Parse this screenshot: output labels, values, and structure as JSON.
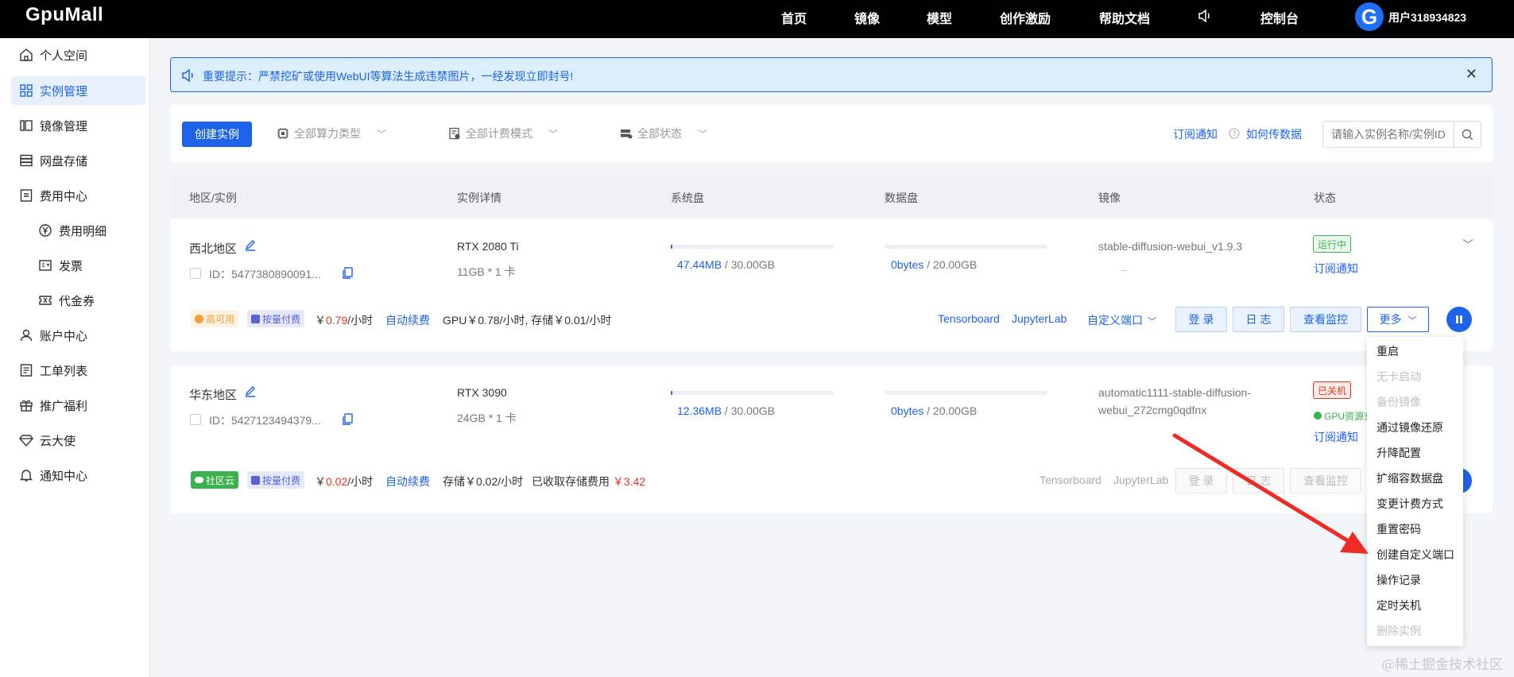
{
  "topbar": {
    "logo": "GpuMall",
    "nav": [
      "首页",
      "镜像",
      "模型",
      "创作激励",
      "帮助文档"
    ],
    "console": "控制台",
    "avatar_letter": "G",
    "username": "用户318934823"
  },
  "sidebar": {
    "items": [
      {
        "label": "个人空间",
        "icon": "home-icon"
      },
      {
        "label": "实例管理",
        "icon": "grid-icon"
      },
      {
        "label": "镜像管理",
        "icon": "mirror-icon"
      },
      {
        "label": "网盘存储",
        "icon": "storage-icon"
      },
      {
        "label": "费用中心",
        "icon": "billing-icon"
      },
      {
        "label": "费用明细",
        "icon": "yen-icon"
      },
      {
        "label": "发票",
        "icon": "invoice-icon"
      },
      {
        "label": "代金券",
        "icon": "coupon-icon"
      },
      {
        "label": "账户中心",
        "icon": "user-icon"
      },
      {
        "label": "工单列表",
        "icon": "ticket-icon"
      },
      {
        "label": "推广福利",
        "icon": "gift-icon"
      },
      {
        "label": "云大使",
        "icon": "diamond-icon"
      },
      {
        "label": "通知中心",
        "icon": "bell-icon"
      }
    ]
  },
  "notice": {
    "text": "重要提示：严禁挖矿或使用WebUI等算法生成违禁图片，一经发现立即封号!",
    "close": "✕"
  },
  "toolbar": {
    "create_label": "创建实例",
    "filter_compute": "全部算力类型",
    "filter_billing": "全部计费模式",
    "filter_status": "全部状态",
    "subscribe_link": "订阅通知",
    "transfer_link": "如何传数据",
    "search_placeholder": "请输入实例名称/实例ID"
  },
  "table": {
    "headers": [
      "地区/实例",
      "实例详情",
      "系统盘",
      "数据盘",
      "镜像",
      "状态"
    ]
  },
  "instances": [
    {
      "region": "西北地区",
      "id": "ID：5477380890091...",
      "gpu": "RTX 2080 Ti",
      "gpu_spec": "11GB * 1 卡",
      "sys_used": "47.44MB",
      "sys_total": " / 30.00GB",
      "sys_fill_pct": 1,
      "data_used": "0bytes",
      "data_total": " / 20.00GB",
      "image": "stable-diffusion-webui_v1.9.3",
      "image_line2": "",
      "status": "运行中",
      "status_extra": "",
      "subscribe": "订阅通知",
      "availability": "高可用",
      "pay_mode": "按量付费",
      "price_prefix": "￥",
      "price": "0.79",
      "price_unit": "/小时",
      "renew": "自动续费",
      "cost_detail": "GPU￥0.78/小时, 存储￥0.01/小时",
      "cost_extra": "",
      "tensorboard": "Tensorboard",
      "jupyterlab": "JupyterLab",
      "custom_port": "自定义端口",
      "login": "登 录",
      "log": "日 志",
      "monitor": "查看监控",
      "more": "更多"
    },
    {
      "region": "华东地区",
      "id": "ID：5427123494379...",
      "gpu": "RTX 3090",
      "gpu_spec": "24GB * 1 卡",
      "sys_used": "12.36MB",
      "sys_total": " / 30.00GB",
      "sys_fill_pct": 1,
      "data_used": "0bytes",
      "data_total": " / 20.00GB",
      "image": "automatic1111-stable-diffusion-",
      "image_line2": "webui_272cmg0qdfnx",
      "status": "已关机",
      "status_extra": "GPU资源充",
      "subscribe": "订阅通知",
      "availability": "社区云",
      "pay_mode": "按量付费",
      "price_prefix": "￥",
      "price": "0.02",
      "price_unit": "/小时",
      "renew": "自动续费",
      "cost_detail": "存储￥0.02/小时",
      "cost_extra_label": "已收取存储费用",
      "cost_extra": "￥3.42",
      "tensorboard": "Tensorboard",
      "jupyterlab": "JupyterLab",
      "login": "登 录",
      "log": "日 志",
      "monitor": "查看监控"
    }
  ],
  "more_menu": {
    "items": [
      {
        "label": "重启",
        "enabled": true
      },
      {
        "label": "无卡启动",
        "enabled": false
      },
      {
        "label": "备份镜像",
        "enabled": false
      },
      {
        "label": "通过镜像还原",
        "enabled": true
      },
      {
        "label": "升降配置",
        "enabled": true
      },
      {
        "label": "扩缩容数据盘",
        "enabled": true
      },
      {
        "label": "变更计费方式",
        "enabled": true
      },
      {
        "label": "重置密码",
        "enabled": true
      },
      {
        "label": "创建自定义端口",
        "enabled": true
      },
      {
        "label": "操作记录",
        "enabled": true
      },
      {
        "label": "定时关机",
        "enabled": true
      },
      {
        "label": "删除实例",
        "enabled": false
      }
    ]
  },
  "watermark": "@稀土掘金技术社区",
  "colors": {
    "primary": "#1d63ea",
    "price_red": "#e8321d",
    "running_green": "#3bb24b",
    "stopped_red": "#e8321d",
    "annotation_arrow": "#ee2b24"
  }
}
